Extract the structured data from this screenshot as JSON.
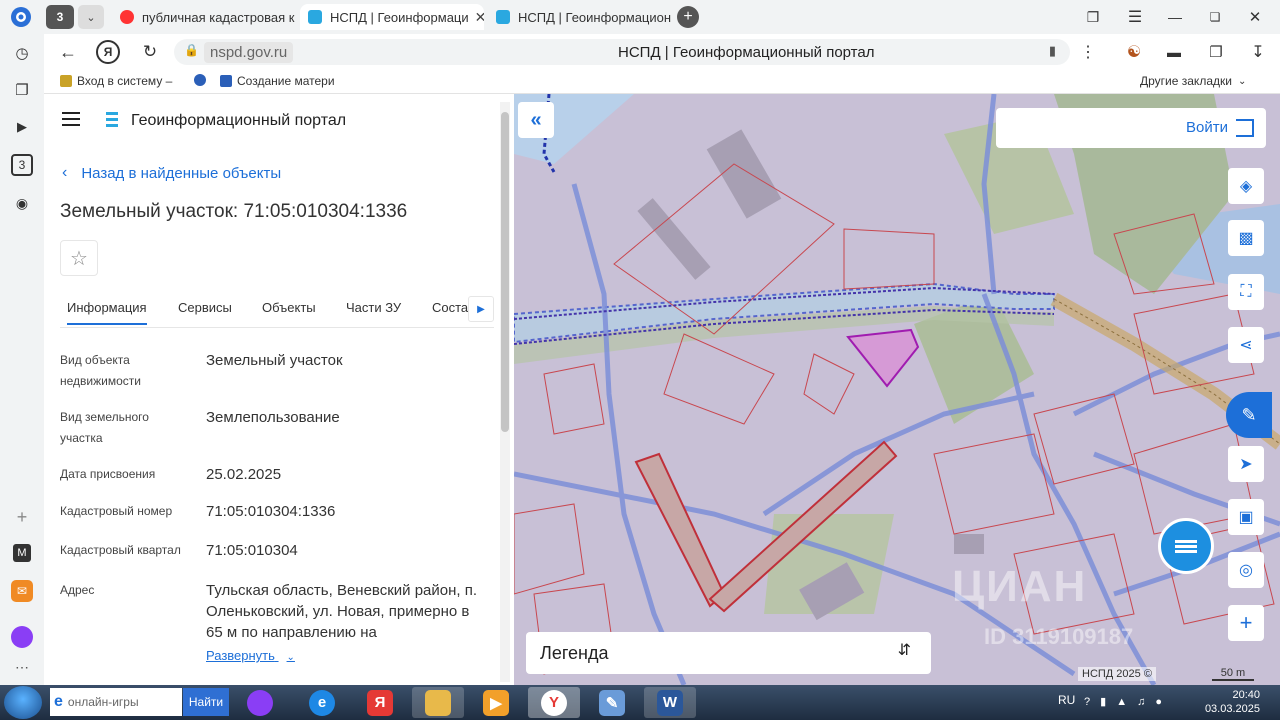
{
  "browser": {
    "tab_count": "3",
    "tabs": [
      {
        "label": "публичная кадастровая к"
      },
      {
        "label": "НСПД | Геоинформаци"
      },
      {
        "label": "НСПД | Геоинформацион"
      }
    ],
    "address": {
      "domain": "nspd.gov.ru",
      "page_title": "НСПД | Геоинформационный портал"
    },
    "bookmarks": [
      {
        "label": "Вход в систему –"
      },
      {
        "label": "Создание матери"
      }
    ],
    "other_bookmarks": "Другие закладки"
  },
  "panel": {
    "header_title": "Геоинформационный портал",
    "back_link": "Назад в найденные объекты",
    "object_title": "Земельный участок: 71:05:010304:1336",
    "tabs": [
      "Информация",
      "Сервисы",
      "Объекты",
      "Части ЗУ",
      "Соста"
    ],
    "attributes": [
      {
        "label": "Вид объекта недвижимости",
        "value": "Земельный участок"
      },
      {
        "label": "Вид земельного участка",
        "value": "Землепользование"
      },
      {
        "label": "Дата присвоения",
        "value": "25.02.2025"
      },
      {
        "label": "Кадастровый номер",
        "value": "71:05:010304:1336"
      },
      {
        "label": "Кадастровый квартал",
        "value": "71:05:010304"
      },
      {
        "label": "Адрес",
        "value": "Тульская область, Веневский район, п. Оленьковский, ул. Новая, примерно в 65 м по направлению на"
      }
    ],
    "expand_label": "Развернуть"
  },
  "map": {
    "login_label": "Войти",
    "legend_label": "Легенда",
    "copyright": "НСПД 2025 ©",
    "scale": "50 m",
    "watermark": "ЦИАН",
    "watermark_id": "ID 3119109187"
  },
  "taskbar": {
    "search_placeholder": "онлайн-игры",
    "search_button": "Найти",
    "language": "RU",
    "time": "20:40",
    "date": "03.03.2025"
  }
}
